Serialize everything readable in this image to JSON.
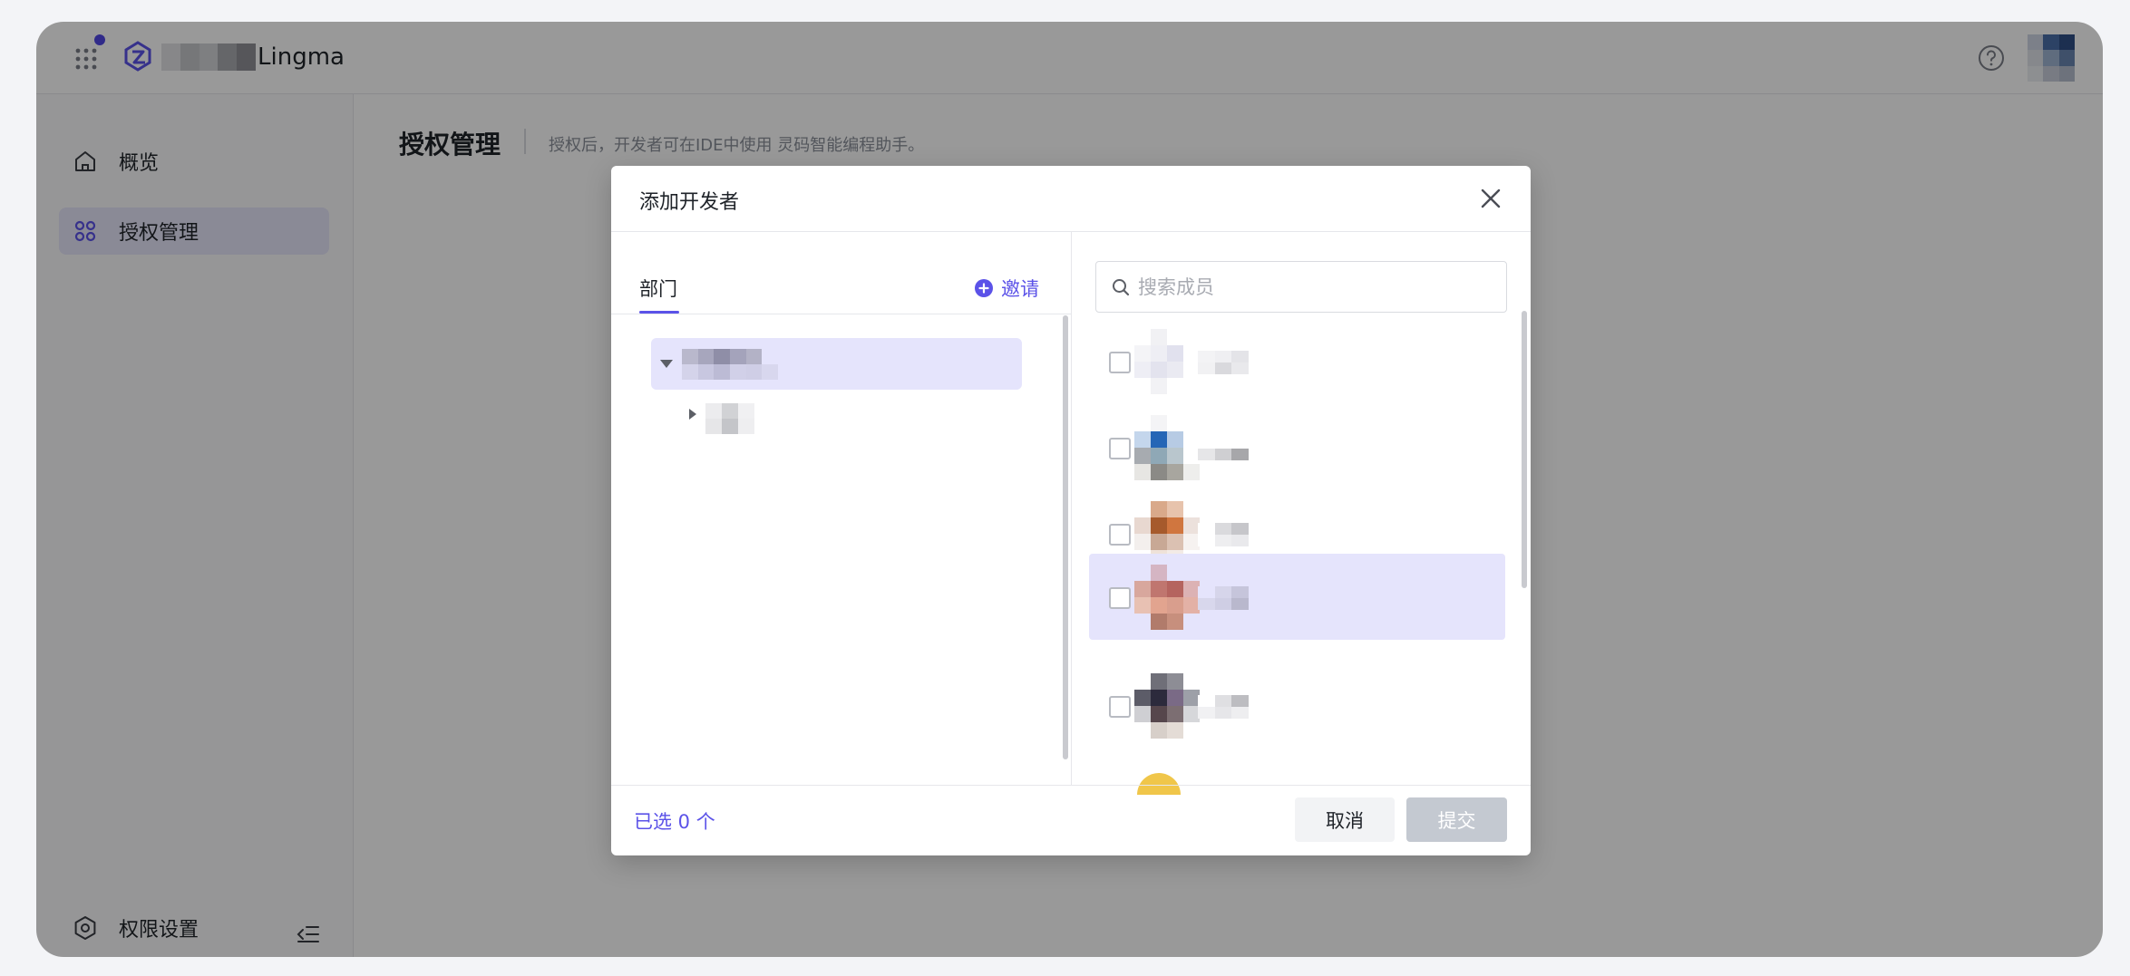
{
  "app": {
    "brand_name": "Lingma",
    "has_notification": true
  },
  "sidebar": {
    "items": [
      {
        "label": "概览",
        "icon": "home-icon",
        "active": false
      },
      {
        "label": "授权管理",
        "icon": "apps-icon",
        "active": true
      }
    ],
    "bottom": {
      "label": "权限设置",
      "icon": "settings-icon"
    }
  },
  "main": {
    "title": "授权管理",
    "description": "授权后，开发者可在IDE中使用       灵码智能编程助手。"
  },
  "dialog": {
    "title": "添加开发者",
    "left_tab": "部门",
    "invite_label": "邀请",
    "search_placeholder": "搜索成员",
    "selected_text": "已选 0 个",
    "cancel_label": "取消",
    "submit_label": "提交",
    "members": [
      {
        "checked": false,
        "highlighted": false
      },
      {
        "checked": false,
        "highlighted": false
      },
      {
        "checked": false,
        "highlighted": false
      },
      {
        "checked": false,
        "highlighted": true
      },
      {
        "checked": false,
        "highlighted": false
      }
    ]
  },
  "colors": {
    "accent": "#5b52e8",
    "active_bg": "#e5e4fc",
    "overlay": "rgba(0,0,0,0.4)",
    "submit_disabled": "#c4c9d1"
  }
}
